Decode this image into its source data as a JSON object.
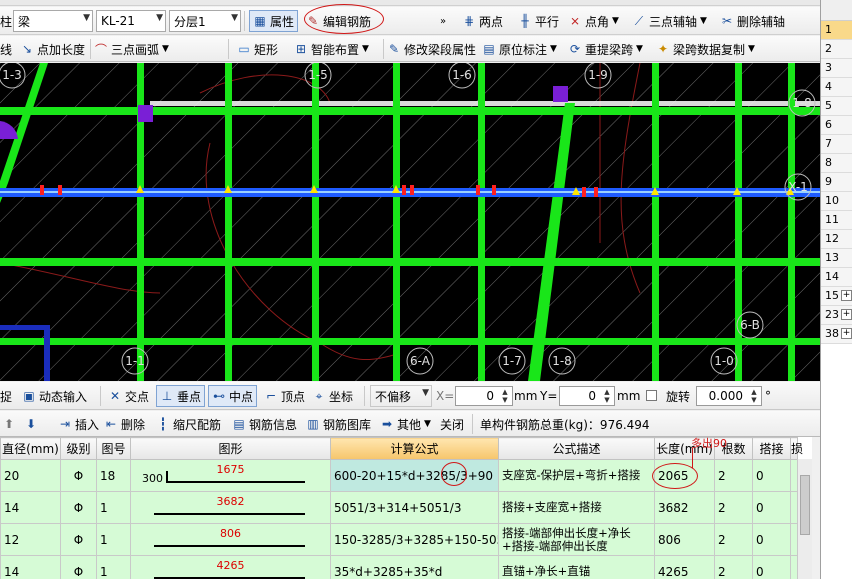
{
  "toolbar1": {
    "partial_label": "柱",
    "type_combo": "梁",
    "name_combo": "KL-21",
    "floor_combo": "分层1",
    "properties": "属性",
    "edit_rebar": "编辑钢筋",
    "two_points": "两点",
    "parallel": "平行",
    "point_angle": "点角",
    "three_point_aux": "三点辅轴",
    "delete_aux": "删除辅轴"
  },
  "toolbar2": {
    "line": "线",
    "add_length": "点加长度",
    "three_point_arc": "三点画弧",
    "rectangle": "矩形",
    "smart_layout": "智能布置",
    "modify_span_props": "修改梁段属性",
    "in_place_annotation": "原位标注",
    "re_extract_span": "重提梁跨",
    "copy_span_data": "梁跨数据复制"
  },
  "canvas": {
    "axis_labels": [
      "1-3",
      "1-5",
      "1-6",
      "1-9",
      "1-8",
      "1-1",
      "6-B",
      "1-0",
      "6-A",
      "1-7",
      "1-8",
      "X-1"
    ]
  },
  "snapbar": {
    "snap": "捉",
    "dynamic_input": "动态输入",
    "intersection": "交点",
    "perpendicular": "垂点",
    "midpoint": "中点",
    "vertex": "顶点",
    "coordinate": "坐标",
    "no_offset": "不偏移",
    "x_label": "X=",
    "x_value": "0",
    "mm1": "mm",
    "y_label": "Y=",
    "y_value": "0",
    "mm2": "mm",
    "rotate": "旋转",
    "rotate_value": "0.000",
    "degree": "°"
  },
  "rebarbar": {
    "insert": "插入",
    "delete": "删除",
    "ruler_rebar": "缩尺配筋",
    "rebar_info": "钢筋信息",
    "rebar_library": "钢筋图库",
    "other": "其他",
    "close": "关闭",
    "total_weight_label": "单构件钢筋总重(kg)：976.494"
  },
  "table": {
    "headers": [
      "直径(mm)",
      "级别",
      "图号",
      "图形",
      "计算公式",
      "公式描述",
      "长度(mm)",
      "根数",
      "搭接",
      "损"
    ],
    "rows": [
      {
        "diameter": "20",
        "grade": "Φ",
        "fig": "18",
        "shape_lead": "300",
        "shape_len": "1675",
        "formula": "600-20+15*d+3285/3+90",
        "desc": "支座宽-保护层+弯折+搭接",
        "length": "2065",
        "count": "2",
        "lap": "0"
      },
      {
        "diameter": "14",
        "grade": "Φ",
        "fig": "1",
        "shape_lead": "",
        "shape_len": "3682",
        "formula": "5051/3+314+5051/3",
        "desc": "搭接+支座宽+搭接",
        "length": "3682",
        "count": "2",
        "lap": "0"
      },
      {
        "diameter": "12",
        "grade": "Φ",
        "fig": "1",
        "shape_lead": "",
        "shape_len": "806",
        "formula": "150-3285/3+3285+150-5051/3",
        "desc": "搭接-端部伸出长度+净长+搭接-端部伸出长度",
        "length": "806",
        "count": "2",
        "lap": "0"
      },
      {
        "diameter": "14",
        "grade": "Φ",
        "fig": "1",
        "shape_lead": "",
        "shape_len": "4265",
        "formula": "35*d+3285+35*d",
        "desc": "直锚+净长+直锚",
        "length": "4265",
        "count": "2",
        "lap": "0"
      }
    ]
  },
  "annotation": {
    "note": "多出90"
  },
  "right_pane": {
    "rows": [
      "1",
      "2",
      "3",
      "4",
      "5",
      "6",
      "7",
      "8",
      "9",
      "10",
      "11",
      "12",
      "13",
      "14",
      "15",
      "23",
      "38"
    ]
  },
  "colors": {
    "grid_green": "#19e619",
    "beam_blue": "#1e5bff",
    "annotation_red": "#d01818",
    "row_green": "#d6fbd6"
  }
}
